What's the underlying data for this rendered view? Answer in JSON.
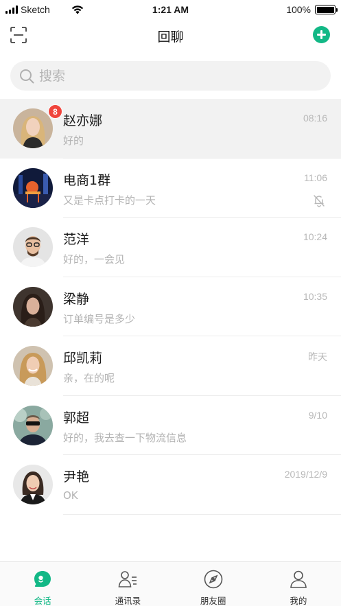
{
  "status_bar": {
    "carrier": "Sketch",
    "time": "1:21 AM",
    "battery": "100%",
    "battery_level": 1.0
  },
  "nav": {
    "title": "回聊",
    "left_icon": "scan-icon",
    "right_icon": "plus-circle-icon"
  },
  "search": {
    "placeholder": "搜索",
    "icon": "search-icon"
  },
  "colors": {
    "accent": "#12b886",
    "badge": "#f0443c",
    "secondary_text": "#b3b3b3"
  },
  "chats": [
    {
      "name": "赵亦娜",
      "message": "好的",
      "time": "08:16",
      "badge": "8",
      "active": true
    },
    {
      "name": "电商1群",
      "message": "又是卡点打卡的一天",
      "time": "11:06",
      "muted": true
    },
    {
      "name": "范洋",
      "message": "好的，一会见",
      "time": "10:24"
    },
    {
      "name": "梁静",
      "message": "订单编号是多少",
      "time": "10:35"
    },
    {
      "name": "邱凯莉",
      "message": "亲，在的呢",
      "time": "昨天"
    },
    {
      "name": "郭超",
      "message": "好的，我去查一下物流信息",
      "time": "9/10"
    },
    {
      "name": "尹艳",
      "message": "OK",
      "time": "2019/12/9"
    }
  ],
  "tabs": [
    {
      "label": "会话",
      "icon": "chat-bubble-icon",
      "active": true
    },
    {
      "label": "通讯录",
      "icon": "contacts-icon"
    },
    {
      "label": "朋友圈",
      "icon": "compass-icon"
    },
    {
      "label": "我的",
      "icon": "person-icon"
    }
  ]
}
